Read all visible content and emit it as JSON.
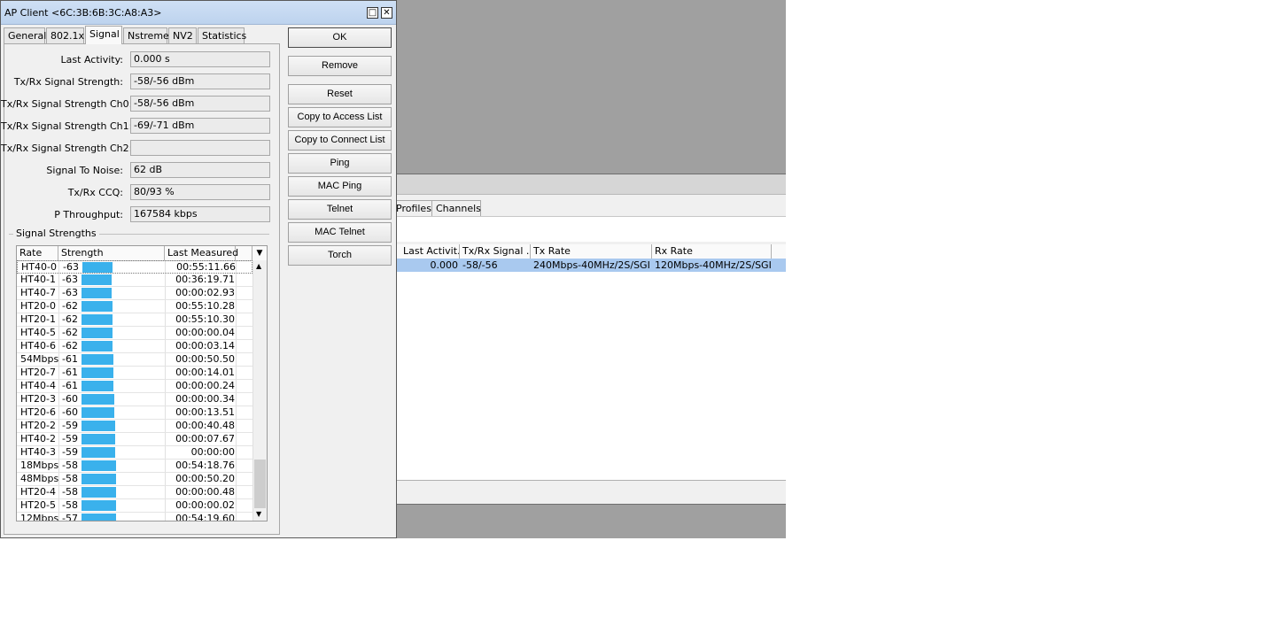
{
  "window": {
    "title": "AP Client <6C:3B:6B:3C:A8:A3>",
    "restore_glyph": "□",
    "close_glyph": "✕"
  },
  "tabs": [
    {
      "label": "General"
    },
    {
      "label": "802.1x"
    },
    {
      "label": "Signal"
    },
    {
      "label": "Nstreme"
    },
    {
      "label": "NV2"
    },
    {
      "label": "Statistics"
    }
  ],
  "active_tab": "Signal",
  "fields": [
    {
      "label": "Last Activity:",
      "value": "0.000 s"
    },
    {
      "label": "Tx/Rx Signal Strength:",
      "value": "-58/-56 dBm"
    },
    {
      "label": "Tx/Rx Signal Strength Ch0:",
      "value": "-58/-56 dBm"
    },
    {
      "label": "Tx/Rx Signal Strength Ch1:",
      "value": "-69/-71 dBm"
    },
    {
      "label": "Tx/Rx Signal Strength Ch2:",
      "value": ""
    },
    {
      "label": "Signal To Noise:",
      "value": "62 dB"
    },
    {
      "label": "Tx/Rx CCQ:",
      "value": "80/93 %"
    },
    {
      "label": "P Throughput:",
      "value": "167584 kbps"
    }
  ],
  "signal_strengths": {
    "group_label": "Signal Strengths",
    "columns": [
      "Rate",
      "Strength",
      "Last Measured"
    ],
    "rows": [
      {
        "rate": "HT40-0",
        "strength": "-63",
        "last": "00:55:11.66"
      },
      {
        "rate": "HT40-1",
        "strength": "-63",
        "last": "00:36:19.71"
      },
      {
        "rate": "HT40-7",
        "strength": "-63",
        "last": "00:00:02.93"
      },
      {
        "rate": "HT20-0",
        "strength": "-62",
        "last": "00:55:10.28"
      },
      {
        "rate": "HT20-1",
        "strength": "-62",
        "last": "00:55:10.30"
      },
      {
        "rate": "HT40-5",
        "strength": "-62",
        "last": "00:00:00.04"
      },
      {
        "rate": "HT40-6",
        "strength": "-62",
        "last": "00:00:03.14"
      },
      {
        "rate": "54Mbps",
        "strength": "-61",
        "last": "00:00:50.50"
      },
      {
        "rate": "HT20-7",
        "strength": "-61",
        "last": "00:00:14.01"
      },
      {
        "rate": "HT40-4",
        "strength": "-61",
        "last": "00:00:00.24"
      },
      {
        "rate": "HT20-3",
        "strength": "-60",
        "last": "00:00:00.34"
      },
      {
        "rate": "HT20-6",
        "strength": "-60",
        "last": "00:00:13.51"
      },
      {
        "rate": "HT20-2",
        "strength": "-59",
        "last": "00:00:40.48"
      },
      {
        "rate": "HT40-2",
        "strength": "-59",
        "last": "00:00:07.67"
      },
      {
        "rate": "HT40-3",
        "strength": "-59",
        "last": "00:00:00"
      },
      {
        "rate": "18Mbps",
        "strength": "-58",
        "last": "00:54:18.76"
      },
      {
        "rate": "48Mbps",
        "strength": "-58",
        "last": "00:00:50.20"
      },
      {
        "rate": "HT20-4",
        "strength": "-58",
        "last": "00:00:00.48"
      },
      {
        "rate": "HT20-5",
        "strength": "-58",
        "last": "00:00:00.02"
      },
      {
        "rate": "12Mbps",
        "strength": "-57",
        "last": "00:54:19.60"
      }
    ],
    "bar_color": "#3ab1ec"
  },
  "buttons": [
    {
      "label": "OK",
      "name": "ok-button"
    },
    {
      "label": "Remove",
      "name": "remove-button"
    },
    {
      "label": "Reset",
      "name": "reset-button"
    },
    {
      "label": "Copy to Access List",
      "name": "copy-to-access-list-button"
    },
    {
      "label": "Copy to Connect List",
      "name": "copy-to-connect-list-button"
    },
    {
      "label": "Ping",
      "name": "ping-button"
    },
    {
      "label": "MAC Ping",
      "name": "mac-ping-button"
    },
    {
      "label": "Telnet",
      "name": "telnet-button"
    },
    {
      "label": "MAC Telnet",
      "name": "mac-telnet-button"
    },
    {
      "label": "Torch",
      "name": "torch-button"
    }
  ],
  "background_window": {
    "tabs": [
      "Profiles",
      "Channels"
    ],
    "columns": [
      "Last Activit...",
      "Tx/Rx Signal ...",
      "Tx Rate",
      "Rx Rate"
    ],
    "row": {
      "last_activity": "0.000",
      "signal": "-58/-56",
      "tx_rate": "240Mbps-40MHz/2S/SGI",
      "rx_rate": "120Mbps-40MHz/2S/SGI"
    },
    "selection_color": "#a9c9ef"
  },
  "icons": {
    "scroll_up": "▲",
    "scroll_down": "▼",
    "column_menu": "▼"
  }
}
